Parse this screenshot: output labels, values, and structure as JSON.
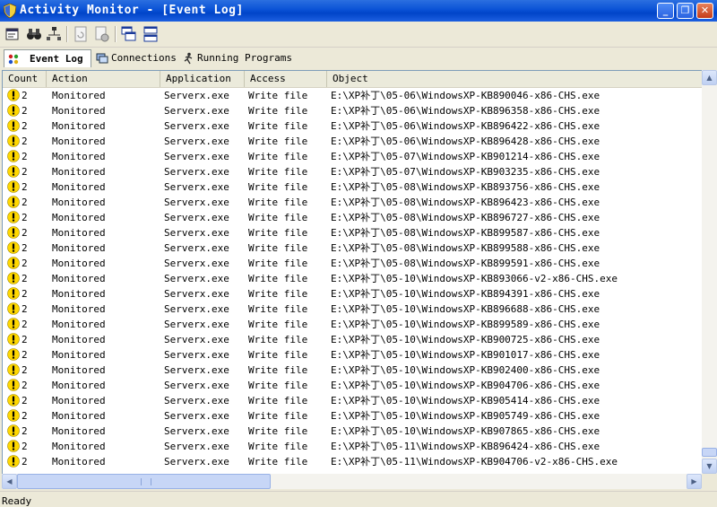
{
  "window": {
    "title": "Activity Monitor - [Event Log]",
    "minimize": "_",
    "restore": "❐",
    "close": "✕"
  },
  "toolbar": {
    "buttons": [
      "properties-icon",
      "binoculars-icon",
      "network-icon",
      "doc-refresh-icon",
      "doc-settings-icon",
      "cascade-windows-icon",
      "tile-windows-icon"
    ]
  },
  "tabs": [
    {
      "label": "Event Log",
      "icon": "event-log-icon",
      "active": true
    },
    {
      "label": "Connections",
      "icon": "connections-icon",
      "active": false
    },
    {
      "label": "Running Programs",
      "icon": "running-programs-icon",
      "active": false
    }
  ],
  "columns": [
    "Count",
    "Action",
    "Application",
    "Access",
    "Object"
  ],
  "rows": [
    {
      "count": "2",
      "action": "Monitored",
      "application": "Serverx.exe",
      "access": "Write file",
      "object": "E:\\XP补丁\\05-06\\WindowsXP-KB890046-x86-CHS.exe"
    },
    {
      "count": "2",
      "action": "Monitored",
      "application": "Serverx.exe",
      "access": "Write file",
      "object": "E:\\XP补丁\\05-06\\WindowsXP-KB896358-x86-CHS.exe"
    },
    {
      "count": "2",
      "action": "Monitored",
      "application": "Serverx.exe",
      "access": "Write file",
      "object": "E:\\XP补丁\\05-06\\WindowsXP-KB896422-x86-CHS.exe"
    },
    {
      "count": "2",
      "action": "Monitored",
      "application": "Serverx.exe",
      "access": "Write file",
      "object": "E:\\XP补丁\\05-06\\WindowsXP-KB896428-x86-CHS.exe"
    },
    {
      "count": "2",
      "action": "Monitored",
      "application": "Serverx.exe",
      "access": "Write file",
      "object": "E:\\XP补丁\\05-07\\WindowsXP-KB901214-x86-CHS.exe"
    },
    {
      "count": "2",
      "action": "Monitored",
      "application": "Serverx.exe",
      "access": "Write file",
      "object": "E:\\XP补丁\\05-07\\WindowsXP-KB903235-x86-CHS.exe"
    },
    {
      "count": "2",
      "action": "Monitored",
      "application": "Serverx.exe",
      "access": "Write file",
      "object": "E:\\XP补丁\\05-08\\WindowsXP-KB893756-x86-CHS.exe"
    },
    {
      "count": "2",
      "action": "Monitored",
      "application": "Serverx.exe",
      "access": "Write file",
      "object": "E:\\XP补丁\\05-08\\WindowsXP-KB896423-x86-CHS.exe"
    },
    {
      "count": "2",
      "action": "Monitored",
      "application": "Serverx.exe",
      "access": "Write file",
      "object": "E:\\XP补丁\\05-08\\WindowsXP-KB896727-x86-CHS.exe"
    },
    {
      "count": "2",
      "action": "Monitored",
      "application": "Serverx.exe",
      "access": "Write file",
      "object": "E:\\XP补丁\\05-08\\WindowsXP-KB899587-x86-CHS.exe"
    },
    {
      "count": "2",
      "action": "Monitored",
      "application": "Serverx.exe",
      "access": "Write file",
      "object": "E:\\XP补丁\\05-08\\WindowsXP-KB899588-x86-CHS.exe"
    },
    {
      "count": "2",
      "action": "Monitored",
      "application": "Serverx.exe",
      "access": "Write file",
      "object": "E:\\XP补丁\\05-08\\WindowsXP-KB899591-x86-CHS.exe"
    },
    {
      "count": "2",
      "action": "Monitored",
      "application": "Serverx.exe",
      "access": "Write file",
      "object": "E:\\XP补丁\\05-10\\WindowsXP-KB893066-v2-x86-CHS.exe"
    },
    {
      "count": "2",
      "action": "Monitored",
      "application": "Serverx.exe",
      "access": "Write file",
      "object": "E:\\XP补丁\\05-10\\WindowsXP-KB894391-x86-CHS.exe"
    },
    {
      "count": "2",
      "action": "Monitored",
      "application": "Serverx.exe",
      "access": "Write file",
      "object": "E:\\XP补丁\\05-10\\WindowsXP-KB896688-x86-CHS.exe"
    },
    {
      "count": "2",
      "action": "Monitored",
      "application": "Serverx.exe",
      "access": "Write file",
      "object": "E:\\XP补丁\\05-10\\WindowsXP-KB899589-x86-CHS.exe"
    },
    {
      "count": "2",
      "action": "Monitored",
      "application": "Serverx.exe",
      "access": "Write file",
      "object": "E:\\XP补丁\\05-10\\WindowsXP-KB900725-x86-CHS.exe"
    },
    {
      "count": "2",
      "action": "Monitored",
      "application": "Serverx.exe",
      "access": "Write file",
      "object": "E:\\XP补丁\\05-10\\WindowsXP-KB901017-x86-CHS.exe"
    },
    {
      "count": "2",
      "action": "Monitored",
      "application": "Serverx.exe",
      "access": "Write file",
      "object": "E:\\XP补丁\\05-10\\WindowsXP-KB902400-x86-CHS.exe"
    },
    {
      "count": "2",
      "action": "Monitored",
      "application": "Serverx.exe",
      "access": "Write file",
      "object": "E:\\XP补丁\\05-10\\WindowsXP-KB904706-x86-CHS.exe"
    },
    {
      "count": "2",
      "action": "Monitored",
      "application": "Serverx.exe",
      "access": "Write file",
      "object": "E:\\XP补丁\\05-10\\WindowsXP-KB905414-x86-CHS.exe"
    },
    {
      "count": "2",
      "action": "Monitored",
      "application": "Serverx.exe",
      "access": "Write file",
      "object": "E:\\XP补丁\\05-10\\WindowsXP-KB905749-x86-CHS.exe"
    },
    {
      "count": "2",
      "action": "Monitored",
      "application": "Serverx.exe",
      "access": "Write file",
      "object": "E:\\XP补丁\\05-10\\WindowsXP-KB907865-x86-CHS.exe"
    },
    {
      "count": "2",
      "action": "Monitored",
      "application": "Serverx.exe",
      "access": "Write file",
      "object": "E:\\XP补丁\\05-11\\WindowsXP-KB896424-x86-CHS.exe"
    },
    {
      "count": "2",
      "action": "Monitored",
      "application": "Serverx.exe",
      "access": "Write file",
      "object": "E:\\XP补丁\\05-11\\WindowsXP-KB904706-v2-x86-CHS.exe"
    }
  ],
  "scrollbars": {
    "up": "▲",
    "down": "▼",
    "left": "◀",
    "right": "▶",
    "vertical_position": 0.97,
    "horizontal_position": 0.0
  },
  "status": {
    "text": "Ready"
  },
  "colors": {
    "titlebar": "#0a52d6",
    "warning": "#ffd800",
    "window_bg": "#ece9d8"
  }
}
